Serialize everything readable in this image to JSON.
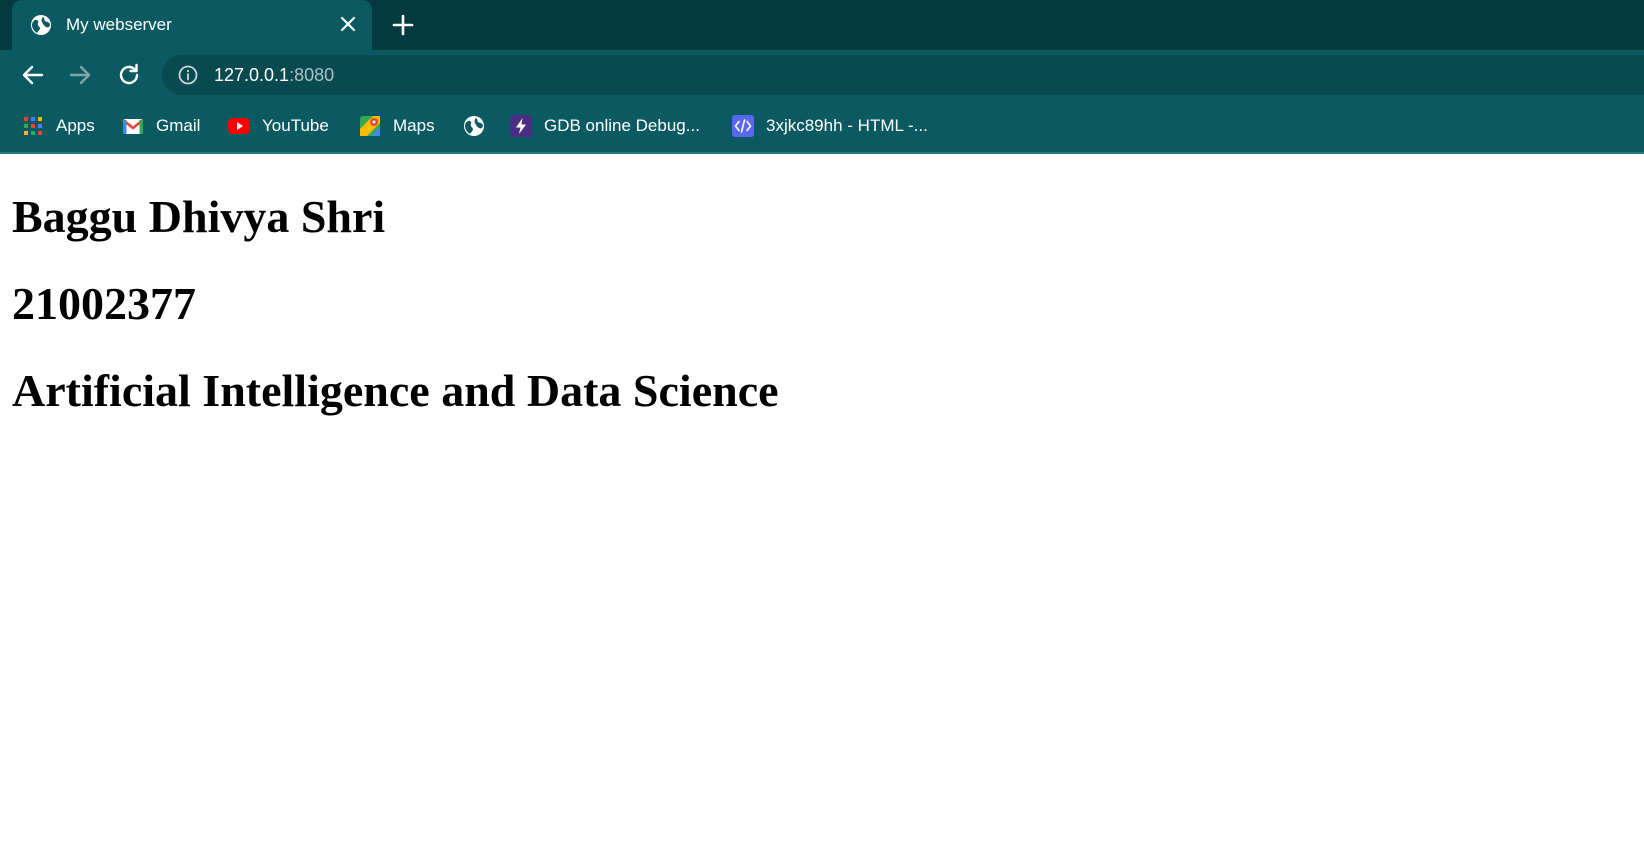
{
  "tab": {
    "title": "My webserver",
    "icon": "globe-icon"
  },
  "toolbar": {
    "url_host": "127.0.0.1",
    "url_port": ":8080"
  },
  "bookmarks": [
    {
      "label": "Apps",
      "icon": "apps-grid-icon"
    },
    {
      "label": "Gmail",
      "icon": "gmail-icon"
    },
    {
      "label": "YouTube",
      "icon": "youtube-icon"
    },
    {
      "label": "Maps",
      "icon": "maps-icon"
    },
    {
      "label": "",
      "icon": "globe-icon"
    },
    {
      "label": "GDB online Debug...",
      "icon": "lightning-icon"
    },
    {
      "label": "3xjkc89hh - HTML -...",
      "icon": "code-icon"
    }
  ],
  "content": {
    "name": "Baggu Dhivya Shri",
    "id": "21002377",
    "department": "Artificial Intelligence and Data Science"
  },
  "colors": {
    "tabstrip": "#033a40",
    "toolbar": "#0b5a62",
    "omnibox": "#084a50",
    "page": "#ffffff"
  }
}
